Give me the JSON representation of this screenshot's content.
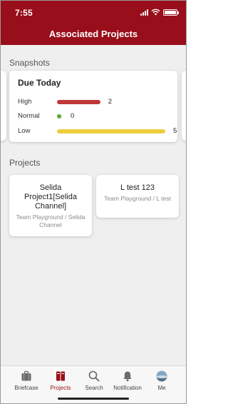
{
  "status_bar": {
    "time": "7:55"
  },
  "header": {
    "title": "Associated Projects"
  },
  "snapshots": {
    "section_label": "Snapshots",
    "card": {
      "title": "Due Today",
      "rows": [
        {
          "label": "High",
          "count": "2",
          "level": 0.4,
          "color": "#c0383a"
        },
        {
          "label": "Normal",
          "count": "0",
          "level": 0,
          "color": "#5aa832"
        },
        {
          "label": "Low",
          "count": "5",
          "level": 1.0,
          "color": "#eccf3e"
        }
      ]
    }
  },
  "projects": {
    "section_label": "Projects",
    "items": [
      {
        "name": "Selida Project1[Selida Channel]",
        "subtitle": "Team Playground / Selida Channel"
      },
      {
        "name": "L test 123",
        "subtitle": "Team Playground / L test"
      }
    ]
  },
  "bottom_nav": {
    "items": [
      {
        "label": "Briefcase",
        "icon": "briefcase-icon"
      },
      {
        "label": "Projects",
        "icon": "projects-icon",
        "active": true
      },
      {
        "label": "Search",
        "icon": "search-icon"
      },
      {
        "label": "Notification",
        "icon": "bell-icon"
      },
      {
        "label": "Me",
        "icon": "avatar"
      }
    ]
  },
  "colors": {
    "brand": "#980e1a",
    "background": "#efefef"
  }
}
